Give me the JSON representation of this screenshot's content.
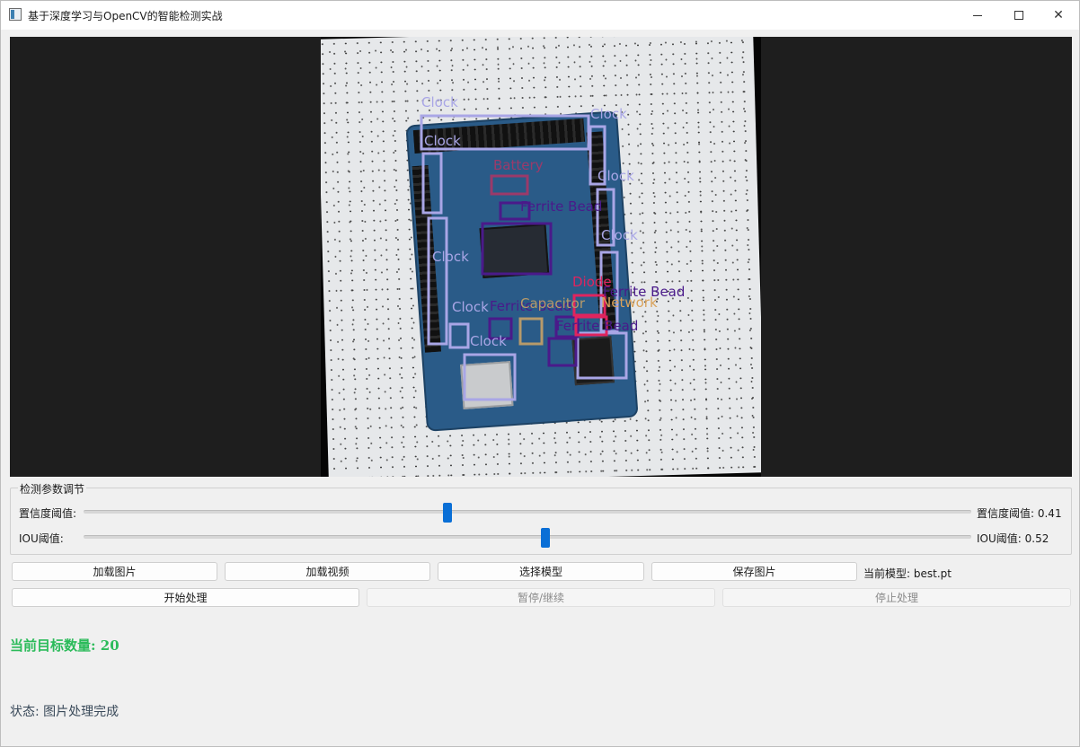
{
  "window": {
    "title": "基于深度学习与OpenCV的智能检测实战",
    "minimize_icon": "minimize-icon",
    "maximize_icon": "maximize-icon",
    "close_icon": "close-icon"
  },
  "display": {
    "detections": [
      {
        "label": "Clock",
        "color": "#a9a6e6"
      },
      {
        "label": "Battery",
        "color": "#9b3a6a"
      },
      {
        "label": "Ferrite Bead",
        "color": "#4a1a8a"
      },
      {
        "label": "Diode",
        "color": "#e0245e"
      },
      {
        "label": "Capacitor",
        "color": "#b79a6a"
      },
      {
        "label": "Network",
        "color": "#d9a25a"
      }
    ]
  },
  "params": {
    "title": "检测参数调节",
    "confidence": {
      "label": "置信度阈值:",
      "value_text": "置信度阈值: 0.41",
      "value": 0.41
    },
    "iou": {
      "label": "IOU阈值:",
      "value_text": "IOU阈值: 0.52",
      "value": 0.52
    }
  },
  "buttons": {
    "load_image": "加载图片",
    "load_video": "加载视频",
    "select_model": "选择模型",
    "save_image": "保存图片",
    "start": "开始处理",
    "pause": "暂停/继续",
    "stop": "停止处理"
  },
  "model": {
    "current_text": "当前模型: best.pt"
  },
  "count": {
    "text": "当前目标数量: 20"
  },
  "status": {
    "text": "状态: 图片处理完成"
  }
}
